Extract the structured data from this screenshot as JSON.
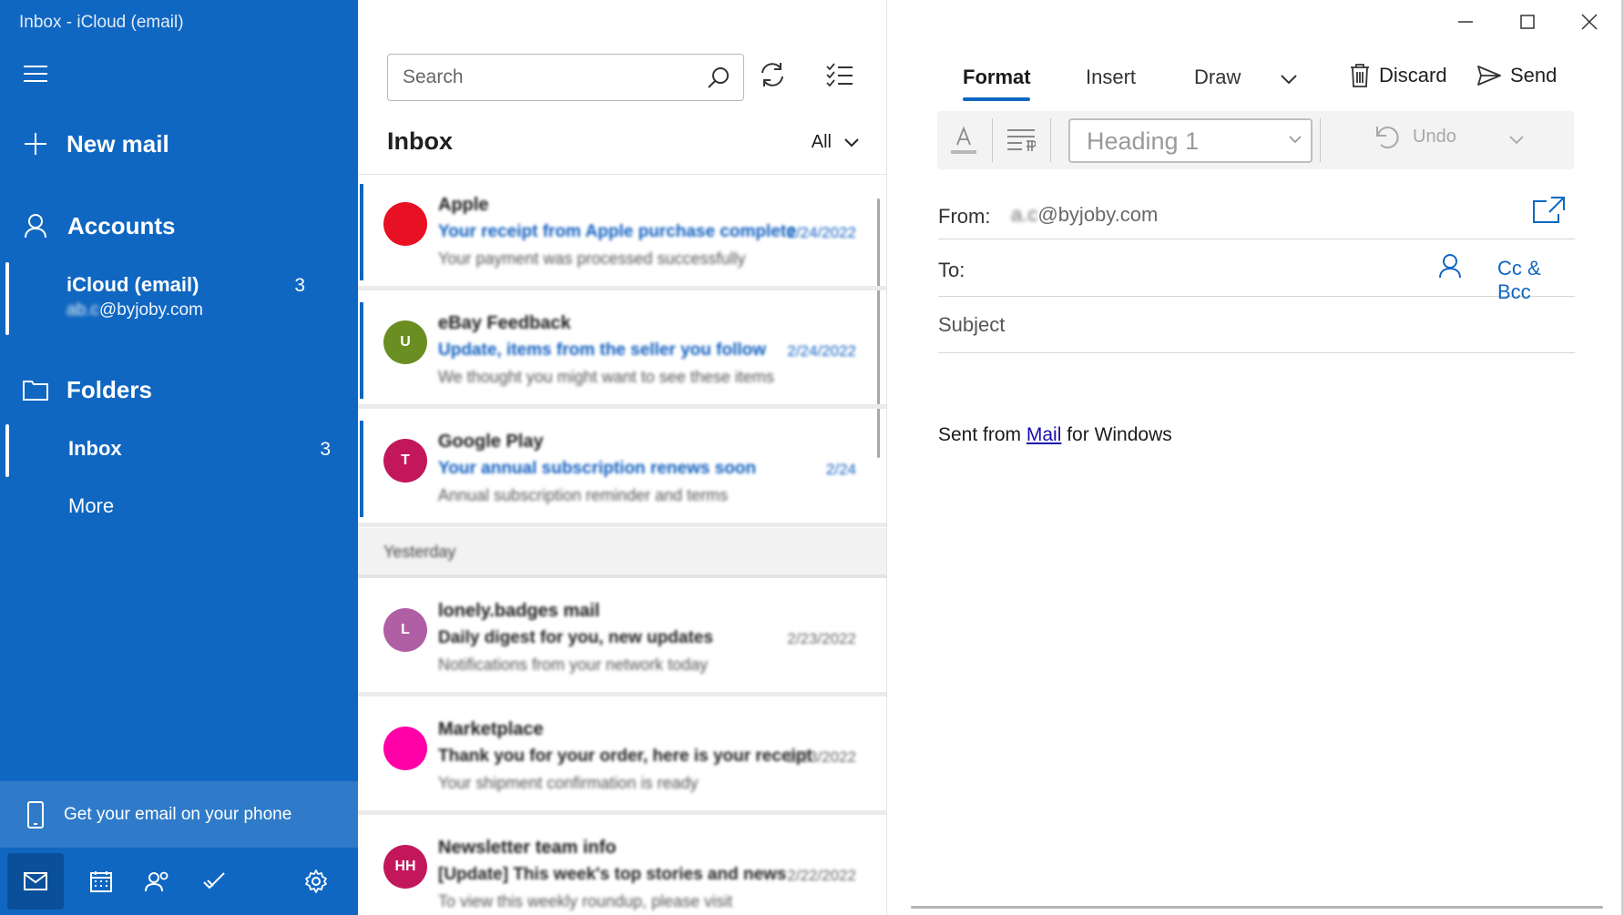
{
  "window": {
    "title": "Inbox - iCloud (email)"
  },
  "nav": {
    "new_mail": "New mail",
    "accounts": "Accounts",
    "account": {
      "name": "iCloud (email)",
      "email_suffix": "@byjoby.com",
      "count": "3"
    },
    "folders": "Folders",
    "folder_items": [
      {
        "label": "Inbox",
        "count": "3"
      },
      {
        "label": "More"
      }
    ],
    "phone_promo": "Get your email on your phone",
    "bottom_icons": [
      "mail-icon",
      "calendar-icon",
      "people-icon",
      "todo-icon",
      "settings-icon"
    ]
  },
  "list": {
    "search_placeholder": "Search",
    "title": "Inbox",
    "filter": "All",
    "messages": [
      {
        "sender": "Apple",
        "subject": "Your receipt from Apple purchase complete",
        "preview": "Your payment was processed successfully",
        "date": "2/24/2022",
        "initial": "",
        "color": "#e81123",
        "unread": true
      },
      {
        "sender": "eBay Feedback",
        "subject": "Update, items from the seller you follow",
        "preview": "We thought you might want to see these items",
        "date": "2/24/2022",
        "initial": "U",
        "color": "#6b8e23",
        "unread": true
      },
      {
        "sender": "Google Play",
        "subject": "Your annual subscription renews soon",
        "preview": "Annual subscription reminder and terms",
        "date": "2/24",
        "initial": "T",
        "color": "#c2185b",
        "unread": true
      },
      {
        "sender": "lonely.badges mail",
        "subject": "Daily digest for you, new updates",
        "preview": "Notifications from your network today",
        "date": "2/23/2022",
        "initial": "L",
        "color": "#b05fa5",
        "unread": false
      },
      {
        "sender": "Marketplace",
        "subject": "Thank you for your order, here is your receipt",
        "preview": "Your shipment confirmation is ready",
        "date": "2/23/2022",
        "initial": "",
        "color": "#ff00a8",
        "unread": false
      },
      {
        "sender": "Newsletter team info",
        "subject": "[Update] This week's top stories and news",
        "preview": "To view this weekly roundup, please visit",
        "date": "2/22/2022",
        "initial": "HH",
        "color": "#c2185b",
        "unread": false
      }
    ],
    "group_header": "Yesterday"
  },
  "compose": {
    "tabs": [
      "Format",
      "Insert",
      "Draw"
    ],
    "discard": "Discard",
    "send": "Send",
    "style_value": "Heading 1",
    "undo": "Undo",
    "from_label": "From:",
    "from_value": "@byjoby.com",
    "to_label": "To:",
    "cc_bcc": "Cc & Bcc",
    "subject_placeholder": "Subject",
    "signature_prefix": "Sent from ",
    "signature_link": "Mail",
    "signature_suffix": " for Windows"
  },
  "colors": {
    "nav_bg": "#1067c1",
    "accent": "#1067c1",
    "promo_bg": "#2f7bc9"
  }
}
